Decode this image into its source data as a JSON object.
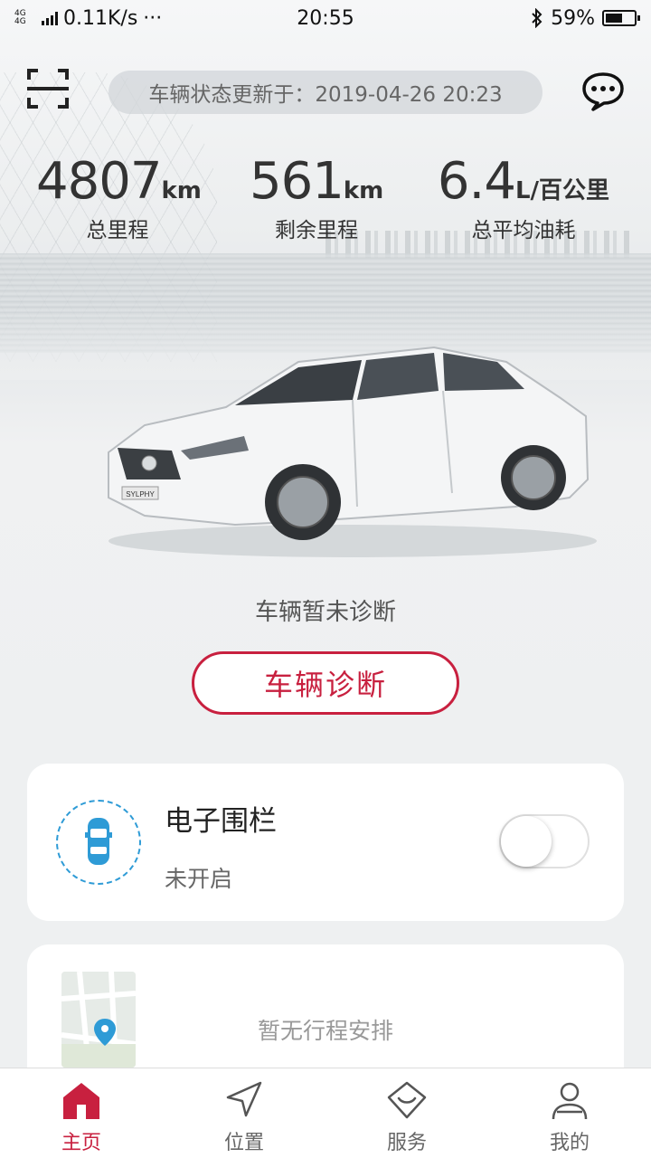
{
  "status_bar": {
    "network_type": "4G 4G",
    "speed": "0.11K/s",
    "more": "···",
    "time": "20:55",
    "bluetooth_icon": "bluetooth-icon",
    "battery": "59%",
    "battery_level": 0.59
  },
  "header": {
    "scan_icon": "scan-icon",
    "update_text": "车辆状态更新于：2019-04-26 20:23",
    "message_icon": "chat-bubble-icon"
  },
  "stats": [
    {
      "value": "4807",
      "unit": "km",
      "label": "总里程"
    },
    {
      "value": "561",
      "unit": "km",
      "label": "剩余里程"
    },
    {
      "value": "6.4",
      "unit": "L/百公里",
      "label": "总平均油耗"
    }
  ],
  "car": {
    "badge": "SYLPHY"
  },
  "diagnosis": {
    "status": "车辆暂未诊断",
    "button": "车辆诊断"
  },
  "fence": {
    "title": "电子围栏",
    "subtitle": "未开启",
    "enabled": false
  },
  "trip": {
    "empty_text": "暂无行程安排"
  },
  "tabs": [
    {
      "label": "主页",
      "icon": "home-icon",
      "active": true
    },
    {
      "label": "位置",
      "icon": "navigation-icon",
      "active": false
    },
    {
      "label": "服务",
      "icon": "service-icon",
      "active": false
    },
    {
      "label": "我的",
      "icon": "user-icon",
      "active": false
    }
  ],
  "colors": {
    "accent": "#c8203f",
    "fence_blue": "#2e9bd6",
    "background": "#eef0f1"
  }
}
